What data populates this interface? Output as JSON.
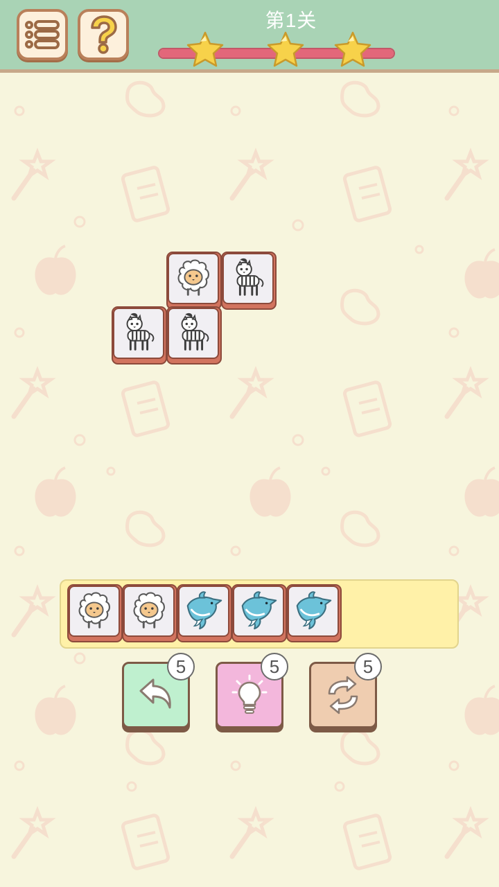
{
  "header": {
    "level_title": "第1关",
    "progress": 1.0,
    "stars_earned": 3,
    "stars_total": 3
  },
  "board": {
    "tiles": [
      {
        "animal": "sheep",
        "name": "tile-sheep"
      },
      {
        "animal": "zebra",
        "name": "tile-zebra"
      },
      {
        "animal": "zebra",
        "name": "tile-zebra"
      },
      {
        "animal": "zebra",
        "name": "tile-zebra"
      }
    ]
  },
  "tray": {
    "capacity": 7,
    "tiles": [
      "sheep",
      "sheep",
      "dolphin",
      "dolphin",
      "dolphin"
    ]
  },
  "powerups": {
    "undo": {
      "icon": "undo-arrow-icon",
      "count": "5"
    },
    "hint": {
      "icon": "lightbulb-icon",
      "count": "5"
    },
    "shuffle": {
      "icon": "shuffle-arrows-icon",
      "count": "5"
    }
  },
  "colors": {
    "background": "#f7f5dd",
    "topbar": "#a9d3b5",
    "progress_fill": "#e3677a",
    "star": "#f7d24a",
    "tray": "#fff1a8"
  }
}
